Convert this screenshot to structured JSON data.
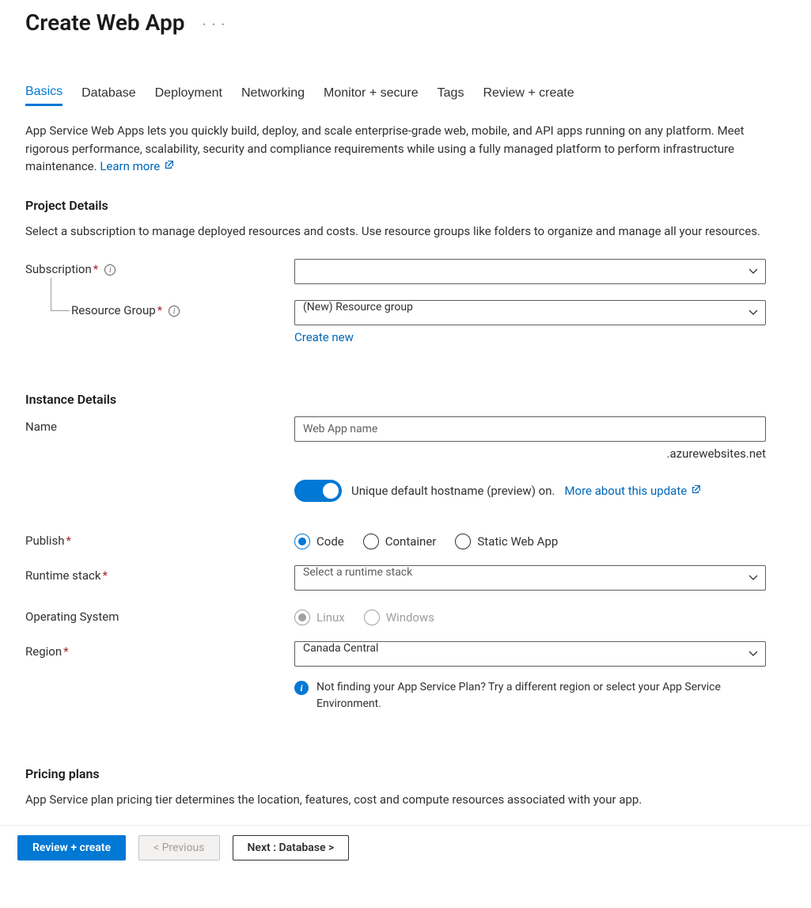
{
  "header": {
    "title": "Create Web App"
  },
  "tabs": [
    {
      "label": "Basics",
      "active": true
    },
    {
      "label": "Database",
      "active": false
    },
    {
      "label": "Deployment",
      "active": false
    },
    {
      "label": "Networking",
      "active": false
    },
    {
      "label": "Monitor + secure",
      "active": false
    },
    {
      "label": "Tags",
      "active": false
    },
    {
      "label": "Review + create",
      "active": false
    }
  ],
  "intro": {
    "text": "App Service Web Apps lets you quickly build, deploy, and scale enterprise-grade web, mobile, and API apps running on any platform. Meet rigorous performance, scalability, security and compliance requirements while using a fully managed platform to perform infrastructure maintenance.  ",
    "learn_more": "Learn more"
  },
  "project_details": {
    "title": "Project Details",
    "desc": "Select a subscription to manage deployed resources and costs. Use resource groups like folders to organize and manage all your resources.",
    "subscription_label": "Subscription",
    "subscription_value": "",
    "resource_group_label": "Resource Group",
    "resource_group_value": "(New) Resource group",
    "create_new": "Create new"
  },
  "instance_details": {
    "title": "Instance Details",
    "name_label": "Name",
    "name_placeholder": "Web App name",
    "name_value": "",
    "domain_suffix": ".azurewebsites.net",
    "hostname_toggle_label": "Unique default hostname (preview) on.",
    "hostname_more_link": "More about this update",
    "publish_label": "Publish",
    "publish_options": [
      {
        "label": "Code",
        "selected": true
      },
      {
        "label": "Container",
        "selected": false
      },
      {
        "label": "Static Web App",
        "selected": false
      }
    ],
    "runtime_label": "Runtime stack",
    "runtime_placeholder": "Select a runtime stack",
    "os_label": "Operating System",
    "os_options": [
      {
        "label": "Linux",
        "selected": true,
        "disabled": true
      },
      {
        "label": "Windows",
        "selected": false,
        "disabled": true
      }
    ],
    "region_label": "Region",
    "region_value": "Canada Central",
    "region_note": "Not finding your App Service Plan? Try a different region or select your App Service Environment."
  },
  "pricing": {
    "title": "Pricing plans",
    "desc": "App Service plan pricing tier determines the location, features, cost and compute resources associated with your app."
  },
  "footer": {
    "review": "Review + create",
    "previous": "< Previous",
    "next": "Next : Database >"
  }
}
